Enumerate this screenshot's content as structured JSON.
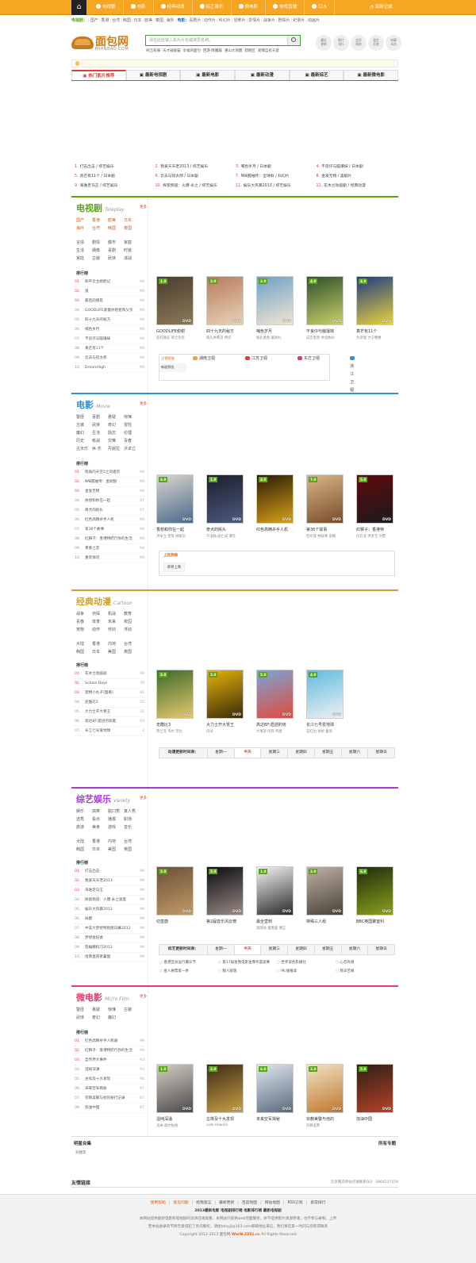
{
  "topnav": {
    "items": [
      "电视剧",
      "电影",
      "经典动漫",
      "综艺娱乐",
      "微电影",
      "电视直播",
      "口水"
    ],
    "login": "最新记录"
  },
  "catbar": {
    "label": "电视剧：",
    "regions": [
      "国产",
      "香港",
      "台湾",
      "韩国",
      "日本",
      "欧美",
      "泰国",
      "海外"
    ],
    "movie_label": "电影：",
    "movie_types": [
      "喜剧片",
      "动作片",
      "科幻片",
      "恐怖片",
      "爱情片",
      "战争片",
      "剧情片",
      "纪录片",
      "动画片"
    ]
  },
  "logo": {
    "name": "面包网",
    "domain": "MIANBAO.COM"
  },
  "search": {
    "placeholder": "请在此处输入影片片名或演员名称。"
  },
  "hot_keywords": [
    "纯洁有罪",
    "天才碰碰猫",
    "幸福的面包",
    "西游·降魔篇",
    "重山大地震",
    "猎物区",
    "爱情自有天意"
  ],
  "quick_links": [
    [
      "最近",
      "更新"
    ],
    [
      "影片",
      "排行"
    ],
    [
      "会员",
      "帮助"
    ],
    [
      "留言",
      "反馈"
    ],
    [
      "收藏",
      "本站"
    ]
  ],
  "tabs": [
    "热门影片推荐",
    "最新电视剧",
    "最新电影",
    "最新动漫",
    "最新综艺",
    "最新微电影"
  ],
  "hot_list": [
    "打击出击 / 综艺娱乐",
    "我爱天天老2013 / 综艺娱乐",
    "哺色岁月 / 日本剧",
    "不良仔与脑壤妹 / 日本剧",
    "真芒有11个 / 日本剧",
    "云去与窃太郎 / 日本剧",
    "N咪醒袖传：全球斜 / 科幻片",
    "金发无物 / 喜剧片",
    "海谁走马王 / 综艺娱乐",
    "探索频道：火爆·永之 / 综艺娱乐",
    "娱乐大风暴2013 / 综艺娱乐",
    "花木兰动画剧 / 经典动漫"
  ],
  "tv": {
    "title": "电视剧",
    "en": "Teleplay",
    "more": "更多",
    "regions": [
      "国产",
      "香港",
      "欧美",
      "日本",
      "海外",
      "台湾",
      "韩国",
      "泰国"
    ],
    "genres": [
      "言情",
      "剧情",
      "都市",
      "家庭",
      "生活",
      "偶像",
      "喜剧",
      "时装",
      "宫廷",
      "古装",
      "武侠",
      "谍战"
    ],
    "rank_title": "排行榜",
    "rank": [
      {
        "no": "01.",
        "t": "和平云主媳鹤记",
        "s": "99"
      },
      {
        "no": "02.",
        "t": "道",
        "s": "99"
      },
      {
        "no": "03.",
        "t": "最后的朋友",
        "s": "99"
      },
      {
        "no": "04.",
        "t": "GOODLIFE爱着你爸爸和父亲",
        "s": "99"
      },
      {
        "no": "05.",
        "t": "四十九天的秘方",
        "s": "99"
      },
      {
        "no": "06.",
        "t": "哺色岁月",
        "s": "99"
      },
      {
        "no": "07.",
        "t": "不良仔与脑壤妹",
        "s": "99"
      },
      {
        "no": "08.",
        "t": "真芒有11个",
        "s": "99"
      },
      {
        "no": "09.",
        "t": "云去与窃太郎",
        "s": "99"
      },
      {
        "no": "10.",
        "t": "DreamHigh",
        "s": "99"
      }
    ],
    "posters": [
      {
        "score": "1.0",
        "title": "GOODLIFE谢谢",
        "cast": "反町隆史 荣仓奈奈",
        "c1": "#4a3d2e",
        "c2": "#8c7a5a"
      },
      {
        "score": "2.0",
        "title": "四十九天的秘方",
        "cast": "和久井映见 伊武",
        "c1": "#b97b5c",
        "c2": "#e8d3b7"
      },
      {
        "score": "2.0",
        "title": "哺色岁月",
        "cast": "堀北真希 薬師丸",
        "c1": "#6ea0c8",
        "c2": "#f1e7d1"
      },
      {
        "score": "4.0",
        "title": "不良仔与脑壤妹",
        "cast": "成宫宽贵 仲里依纱",
        "c1": "#2f4f2a",
        "c2": "#c9d16b"
      },
      {
        "score": "4.0",
        "title": "真芒有11个",
        "cast": "大泽瑞 力宁惠惠",
        "c1": "#1e3c82",
        "c2": "#e9d23c"
      }
    ],
    "tv_h1": "卫视频道",
    "tv_h2": "新剧预告",
    "channels": [
      "湖南卫视",
      "江苏卫视",
      "东方卫视",
      "浙江卫视"
    ]
  },
  "movie": {
    "title": "电影",
    "en": "Movie",
    "more": "更多",
    "genres": [
      "警匪",
      "喜剧",
      "悬疑",
      "惊悚",
      "古装",
      "武侠",
      "奇幻",
      "冒险",
      "魔幻",
      "生活",
      "励志",
      "伦理",
      "历史",
      "枪战",
      "灾难",
      "青春",
      "古天乐",
      "休·杰",
      "丹妮拉",
      "沃卓立"
    ],
    "rank_title": "排行榜",
    "rank": [
      {
        "no": "01.",
        "t": "暗角的天空2之凤姐衣",
        "s": "99"
      },
      {
        "no": "02.",
        "t": "N咪醒袖传：金刚狼",
        "s": "99"
      },
      {
        "no": "03.",
        "t": "金发无物",
        "s": "99"
      },
      {
        "no": "04.",
        "t": "依想和你在一起",
        "s": "97"
      },
      {
        "no": "05.",
        "t": "奇犬的街头",
        "s": "97"
      },
      {
        "no": "06.",
        "t": "红色高精杀手人机",
        "s": "99"
      },
      {
        "no": "07.",
        "t": "第36个故事",
        "s": "99"
      },
      {
        "no": "08.",
        "t": "红狮子：香港特府行你的生活",
        "s": "99"
      },
      {
        "no": "09.",
        "t": "青春之恋",
        "s": "94"
      },
      {
        "no": "10.",
        "t": "重装择问",
        "s": "99"
      }
    ],
    "posters": [
      {
        "score": "6.0",
        "title": "香想和你在一起",
        "cast": "洪卓立 曾珠 顾家乐",
        "c1": "#d8d4cf",
        "c2": "#4c6b8a"
      },
      {
        "score": "1.0",
        "title": "奇犬的街头",
        "cast": "千浅陆 赵亡成 谭宝",
        "c1": "#1c1e2a",
        "c2": "#4d5a80"
      },
      {
        "score": "4.0",
        "title": "红色高精杀手人机",
        "cast": "",
        "c1": "#2a1a05",
        "c2": "#d8a21a"
      },
      {
        "score": "7.0",
        "title": "第36个故事",
        "cast": "桂纶镁 林辰唏 张翰",
        "c1": "#d9b686",
        "c2": "#784c2a"
      },
      {
        "score": "5.0",
        "title": "红狮子：香港特",
        "cast": "仇云波 洪金宝 刘雯",
        "c1": "#60090c",
        "c2": "#1b1b1b"
      }
    ],
    "hot_h": "上百热映",
    "hot_x": "即将上映"
  },
  "anime": {
    "title": "经典动漫",
    "en": "Cartoon",
    "more": "",
    "genres": [
      "战争",
      "侦探",
      "机战",
      "教育",
      "青春",
      "体育",
      "未来",
      "校园",
      "宠物",
      "动作",
      "怀旧",
      "浮动"
    ],
    "regions": [
      "大陆",
      "香港",
      "内地",
      "台湾",
      "韩国",
      "日本",
      "美国",
      "英国"
    ],
    "rank_title": "排行榜",
    "rank": [
      {
        "no": "01.",
        "t": "花木兰动画剧",
        "s": "98"
      },
      {
        "no": "02.",
        "t": "School Days",
        "s": "70"
      },
      {
        "no": "03.",
        "t": "猎物小丸子(国看)",
        "s": "91"
      },
      {
        "no": "04.",
        "t": "史酷比3",
        "s": "25"
      },
      {
        "no": "05.",
        "t": "大力士开大胃王",
        "s": "31"
      },
      {
        "no": "06.",
        "t": "高达BF:遗迹的铳着",
        "s": "93"
      },
      {
        "no": "07.",
        "t": "长江七号爱地球",
        "s": "2"
      }
    ],
    "posters": [
      {
        "score": "5.0",
        "title": "史酷比3",
        "cast": "弗兰克 韦尔 罗比",
        "c1": "#3d6b2a",
        "c2": "#e6c86e"
      },
      {
        "score": "3.0",
        "title": "大力士开大胃王",
        "cast": "内详",
        "c1": "#e5b20c",
        "c2": "#3a2a08"
      },
      {
        "score": "5.0",
        "title": "高达BF:遗迹的铳",
        "cast": "大塚游 阿宾 明星",
        "c1": "#7aa4d8",
        "c2": "#e14b3a"
      },
      {
        "score": "4.0",
        "title": "长江七号爱地球",
        "cast": "石红垃 徐娇 童语",
        "c1": "#5dbbe0",
        "c2": "#f0f0f0"
      }
    ],
    "sched_h": "动漫更新时间表：",
    "days": [
      "星期一",
      "今天",
      "星期三",
      "星期四",
      "星期五",
      "星期六",
      "星期日"
    ]
  },
  "variety": {
    "title": "综艺娱乐",
    "en": "Variety",
    "more": "更多",
    "genres": [
      "娱乐",
      "搞笑",
      "脱口秀",
      "真人秀",
      "选秀",
      "看点",
      "播报",
      "职场",
      "旅游",
      "美食",
      "游戏",
      "音乐"
    ],
    "regions": [
      "大陆",
      "香港",
      "内地",
      "台湾",
      "韩国",
      "日本",
      "美国",
      "英国"
    ],
    "rank_title": "排行榜",
    "rank": [
      {
        "no": "01.",
        "t": "打击出击",
        "s": "99"
      },
      {
        "no": "02.",
        "t": "我爱天天老2013",
        "s": "99"
      },
      {
        "no": "03.",
        "t": "海谁走马王",
        "s": "99"
      },
      {
        "no": "04.",
        "t": "探索频道：火爆·永之速度",
        "s": "99"
      },
      {
        "no": "05.",
        "t": "娱乐大风暴2013",
        "s": "99"
      },
      {
        "no": "06.",
        "t": "局都",
        "s": "99"
      },
      {
        "no": "07.",
        "t": "中美大梦想特别版日幕2012",
        "s": "99"
      },
      {
        "no": "08.",
        "t": "梦想金纪委",
        "s": "99"
      },
      {
        "no": "09.",
        "t": "怒编撇科刀2013",
        "s": "99"
      },
      {
        "no": "10.",
        "t": "恰救直夜者暑图",
        "s": "99"
      }
    ],
    "posters": [
      {
        "score": "5.0",
        "title": "切皇筋",
        "cast": "",
        "c1": "#6a5236",
        "c2": "#c29a68"
      },
      {
        "score": "5.0",
        "title": "第2届音乐风云榜",
        "cast": "",
        "c1": "#0c0c12",
        "c2": "#9a8a84"
      },
      {
        "score": "1.0",
        "title": "最全营到",
        "cast": "高随坊 童勇喜 傅正",
        "c1": "#f3f3f3",
        "c2": "#2a2a2a"
      },
      {
        "score": "2.0",
        "title": "特殊三人组",
        "cast": "",
        "c1": "#bdb2a3",
        "c2": "#4a4036"
      },
      {
        "score": "6.0",
        "title": "BBC英国聚室科",
        "cast": "",
        "c1": "#1f2a10",
        "c2": "#8aa21b"
      }
    ],
    "sched_h": "综艺更新时间表：",
    "days": [
      "星期一",
      "今天",
      "星期三",
      "星期四",
      "星期五",
      "星期六",
      "星期日"
    ],
    "shows": [
      "香港亚洲运行撮乐节",
      "第17届金像电影金像奖荟诞赛",
      "世界末各影播社",
      "心音有缘",
      "金人换票第一季",
      "靓人部落",
      "Mc服推拿",
      "我辛苦缘"
    ]
  },
  "micro": {
    "title": "微电影",
    "en": "Micro Film",
    "more": "更多",
    "genres": [
      "警匪",
      "悬疑",
      "惊悚",
      "古装",
      "武侠",
      "奇幻",
      "魔幻",
      ""
    ],
    "rank_title": "排行榜",
    "rank": [
      {
        "no": "01.",
        "t": "红色高精杀手人机器",
        "s": "99"
      },
      {
        "no": "02.",
        "t": "红狮子：香港特府行你的生活",
        "s": "99"
      },
      {
        "no": "03.",
        "t": "自然界大事件",
        "s": "93"
      },
      {
        "no": "04.",
        "t": "湿秘深渊",
        "s": "93"
      },
      {
        "no": "05.",
        "t": "古埃及十大发现",
        "s": "94"
      },
      {
        "no": "06.",
        "t": "未来空军揭秘",
        "s": "97"
      },
      {
        "no": "07.",
        "t": "宗教美警与他的秘行记录",
        "s": "87"
      },
      {
        "no": "08.",
        "t": "加油中国",
        "s": "87"
      }
    ],
    "posters": [
      {
        "score": "1.0",
        "title": "湿纯深涌",
        "cast": "沃纳 赫尔佐格",
        "c1": "#d2ccc4",
        "c2": "#4e4a48"
      },
      {
        "score": "2.0",
        "title": "古埃及十大发现",
        "cast": "Zahi Hawass",
        "c1": "#3c2c18",
        "c2": "#caa043"
      },
      {
        "score": "6.0",
        "title": "未来空军揭秘",
        "cast": "",
        "c1": "#dfe6ee",
        "c2": "#5a6b7e"
      },
      {
        "score": "2.0",
        "title": "宗教美警与他的",
        "cast": "宗教美警",
        "c1": "#f0e2c4",
        "c2": "#c0772e"
      },
      {
        "score": "5.0",
        "title": "加油中国",
        "cast": "",
        "c1": "#2c1f14",
        "c2": "#b8432a"
      }
    ]
  },
  "stars": {
    "title": "明星合集",
    "right": "所有专题",
    "value": "刘德华"
  },
  "links": {
    "title": "友情链接",
    "right": "页近两次所站点请联系QQ：2864237159"
  },
  "footer": {
    "links": [
      "使用帮助",
      "意见问题",
      "给我留言",
      "最新更新",
      "百度地图",
      "网站地图",
      "RSS订阅",
      "意常排行"
    ],
    "line1": "2013最新电影 电视剧排行榜 电影排行榜 最新电视剧",
    "line2": "本网站提供最新电影和电视剧的高清在线观看，本网站只提供web页面服务，并不提供影片资源存储，也不参与录制、上传",
    "line3": "若本站收录的节目无意侵犯了贵司版权，请给bdsyjl@163.com邮箱地址来信，我们将在第一时间与您取得联系",
    "copy_pre": "Copyright 2012-2013 面包网",
    "brand": "WwW.2351.cc",
    "copy_post": "All Rights Reserved"
  }
}
